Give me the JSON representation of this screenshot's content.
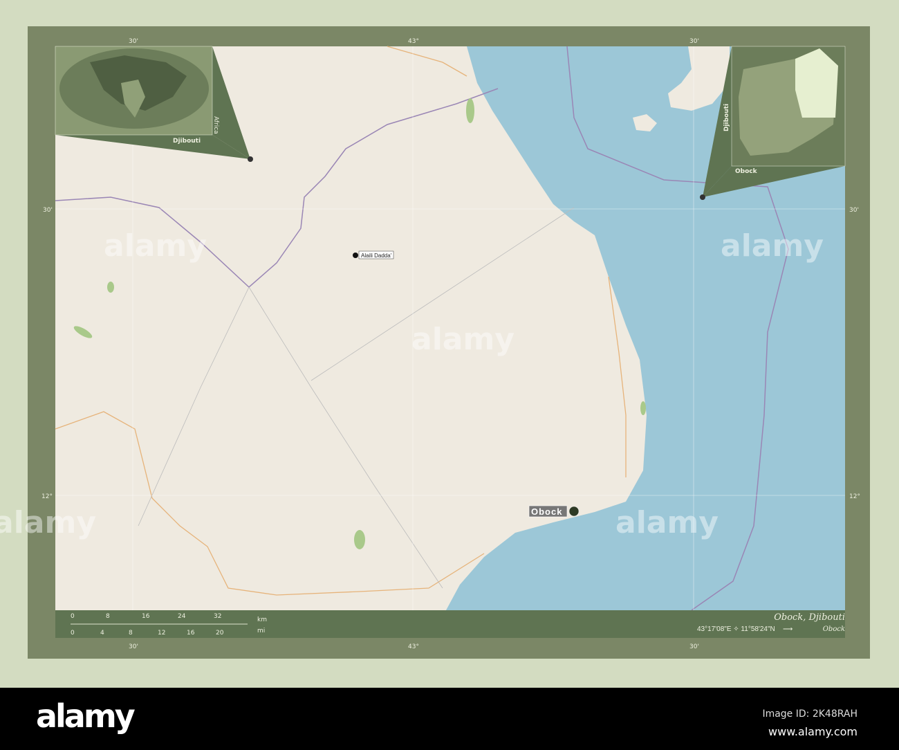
{
  "map": {
    "title": "Obock, Djibouti",
    "coordinates": "43°17'08\"E ✧ 11°58'24\"N",
    "arrow": "⟶",
    "region_name": "Obock",
    "places": {
      "alaili_dadda": "Alaili Dadda'",
      "obock": "Obock"
    },
    "grid": {
      "top": [
        "30'",
        "43°",
        "30'"
      ],
      "left": [
        "30'",
        "12°"
      ],
      "right": [
        "30'",
        "12°"
      ],
      "bottom": [
        "30'",
        "43°",
        "30'"
      ]
    },
    "inset_world": {
      "country": "Djibouti",
      "continent": "Africa"
    },
    "inset_country": {
      "country": "Djibouti",
      "region": "Obock"
    },
    "scale": {
      "km_unit": "km",
      "mi_unit": "mi",
      "km_ticks": [
        "0",
        "8",
        "16",
        "24",
        "32"
      ],
      "mi_ticks": [
        "0",
        "4",
        "8",
        "12",
        "16",
        "20"
      ]
    },
    "colors": {
      "land": "#efeae0",
      "sea": "#9cc7d7",
      "frame": "#7b8766",
      "highlight": "#e6efd0"
    }
  },
  "watermark": "alamy",
  "footer": {
    "logo": "alamy",
    "image_id": "Image ID: 2K48RAH",
    "url": "www.alamy.com"
  }
}
